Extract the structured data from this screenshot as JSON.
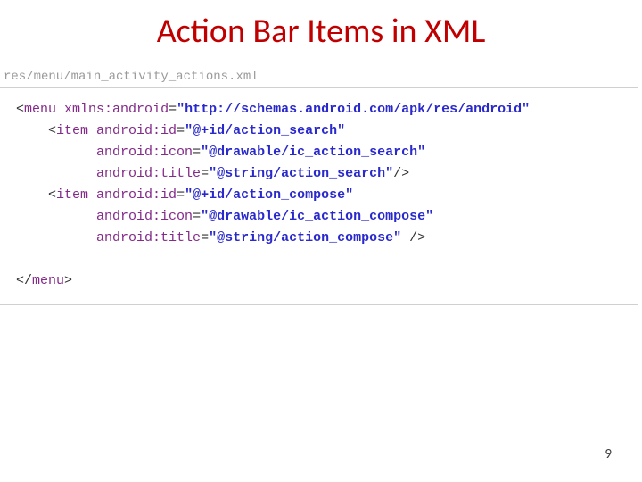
{
  "title": "Action Bar Items in XML",
  "file_path": "res/menu/main_activity_actions.xml",
  "code": {
    "l1": {
      "open": "<",
      "tag": "menu ",
      "attr": "xmlns:android",
      "eq": "=",
      "val": "\"http://schemas.android.com/apk/res/android\""
    },
    "l2": {
      "open": "<",
      "tag": "item ",
      "attr": "android:id",
      "eq": "=",
      "val": "\"@+id/action_search\""
    },
    "l3": {
      "attr": "android:icon",
      "eq": "=",
      "val": "\"@drawable/ic_action_search\""
    },
    "l4": {
      "attr": "android:title",
      "eq": "=",
      "val": "\"@string/action_search\"",
      "close": "/>"
    },
    "l5": {
      "open": "<",
      "tag": "item ",
      "attr": "android:id",
      "eq": "=",
      "val": "\"@+id/action_compose\""
    },
    "l6": {
      "attr": "android:icon",
      "eq": "=",
      "val": "\"@drawable/ic_action_compose\""
    },
    "l7": {
      "attr": "android:title",
      "eq": "=",
      "val": "\"@string/action_compose\"",
      "trail": " ",
      "close": "/>"
    },
    "l8": {
      "open": "</",
      "tag": "menu",
      "close": ">"
    }
  },
  "page_number": "9"
}
